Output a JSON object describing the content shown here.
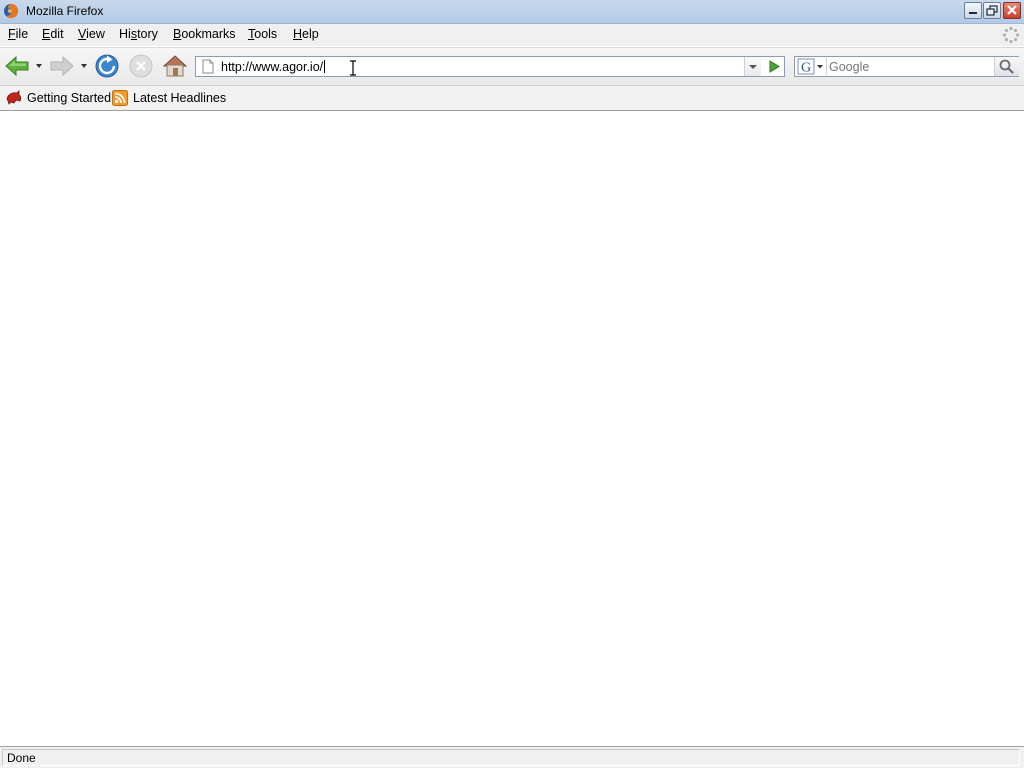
{
  "window": {
    "title": "Mozilla Firefox",
    "controls": {
      "minimize": "minimize-icon",
      "restore": "restore-icon",
      "close": "close-icon"
    }
  },
  "menu": {
    "items": [
      {
        "label": "File",
        "accel": "F"
      },
      {
        "label": "Edit",
        "accel": "E"
      },
      {
        "label": "View",
        "accel": "V"
      },
      {
        "label": "History",
        "accel": "s"
      },
      {
        "label": "Bookmarks",
        "accel": "B"
      },
      {
        "label": "Tools",
        "accel": "T"
      },
      {
        "label": "Help",
        "accel": "H"
      }
    ]
  },
  "navigation": {
    "back_icon": "back-arrow-icon",
    "forward_icon": "forward-arrow-icon",
    "reload_icon": "reload-icon",
    "stop_icon": "stop-icon",
    "home_icon": "home-icon",
    "url": "http://www.agor.io/",
    "search_placeholder": "Google",
    "search_engine": "Google"
  },
  "bookmarks": {
    "items": [
      {
        "label": "Getting Started",
        "icon": "firefox-bookmark-icon"
      },
      {
        "label": "Latest Headlines",
        "icon": "rss-feed-icon"
      }
    ]
  },
  "status": {
    "text": "Done"
  },
  "colors": {
    "titlebar": "#b3cae6",
    "close_button": "#c7412a",
    "back_arrow": "#4c9a2a"
  }
}
